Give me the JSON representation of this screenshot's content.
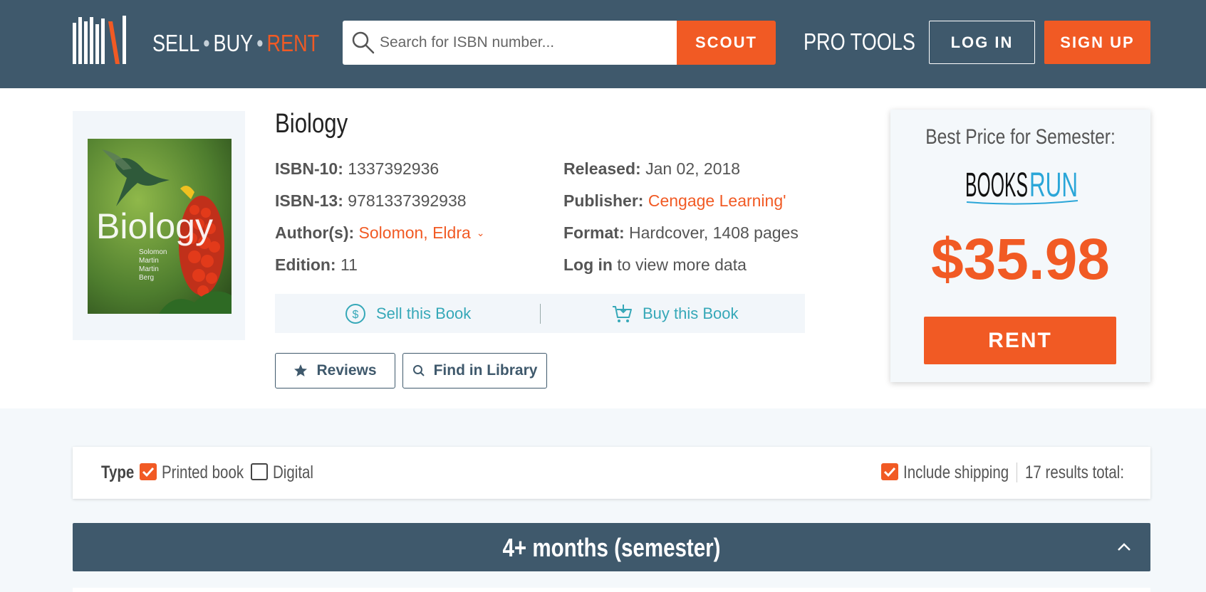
{
  "header": {
    "tagline": {
      "sell": "SELL",
      "buy": "BUY",
      "rent": "RENT",
      "dot": "•"
    },
    "search_placeholder": "Search for ISBN number...",
    "scout_label": "SCOUT",
    "pro_tools_label": "PRO TOOLS",
    "login_label": "LOG IN",
    "signup_label": "SIGN UP",
    "accent_color": "#f15a24",
    "header_color": "#3f596c"
  },
  "book": {
    "title": "Biology",
    "cover": {
      "title": "Biology",
      "authors": [
        "Solomon",
        "Martin",
        "Martin",
        "Berg"
      ]
    },
    "isbn10_label": "ISBN-10:",
    "isbn10": "1337392936",
    "isbn13_label": "ISBN-13:",
    "isbn13": "9781337392938",
    "authors_label": "Author(s):",
    "authors": "Solomon, Eldra",
    "edition_label": "Edition:",
    "edition": "11",
    "released_label": "Released:",
    "released": "Jan 02, 2018",
    "publisher_label": "Publisher:",
    "publisher": "Cengage Learning'",
    "format_label": "Format:",
    "format": "Hardcover, 1408 pages",
    "login_link": "Log in",
    "login_suffix": "to view more data",
    "sell_label": "Sell this Book",
    "buy_label": "Buy this Book",
    "reviews_label": "Reviews",
    "library_label": "Find in Library"
  },
  "price_card": {
    "heading": "Best Price for Semester:",
    "vendor_logo": "BOOKSRUN",
    "price": "$35.98",
    "rent_label": "RENT"
  },
  "filters": {
    "type_label": "Type",
    "printed_label": "Printed book",
    "printed_checked": true,
    "digital_label": "Digital",
    "digital_checked": false,
    "shipping_label": "Include shipping",
    "shipping_checked": true,
    "results_label": "17 results total:"
  },
  "semester": {
    "title": "4+ months (semester)",
    "icon": "chevron-up-icon"
  }
}
